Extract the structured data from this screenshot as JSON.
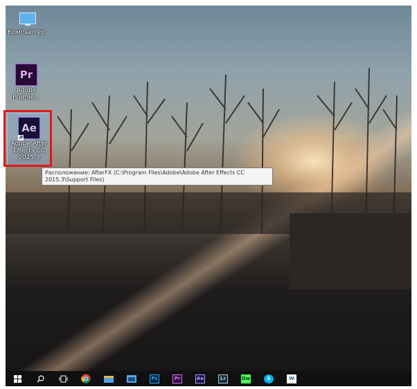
{
  "desktop": {
    "icons": [
      {
        "name": "this-pc",
        "label": "Компьютер"
      },
      {
        "name": "premiere",
        "tile": "Pr",
        "label": "Adobe Premie..."
      },
      {
        "name": "after-effects",
        "tile": "Ae",
        "label": "Adobe After Effects CC 2015.3"
      }
    ]
  },
  "tooltip": {
    "text": "Расположение: AfterFX (C:\\Program Files\\Adobe\\Adobe After Effects CC 2015.3\\Support Files)"
  },
  "taskbar": {
    "items": [
      {
        "name": "start-button",
        "icon": "windows-logo-icon"
      },
      {
        "name": "search-button",
        "icon": "search-icon"
      },
      {
        "name": "task-view-button",
        "icon": "task-view-icon"
      },
      {
        "name": "chrome-button",
        "icon": "chrome-icon"
      },
      {
        "name": "file-explorer-button",
        "icon": "folder-icon"
      },
      {
        "name": "app-button",
        "icon": "app-window-icon"
      },
      {
        "name": "photoshop-button",
        "label": "Ps",
        "color": "#31a8ff"
      },
      {
        "name": "premiere-button",
        "label": "Pr",
        "color": "#d77bff"
      },
      {
        "name": "after-effects-button",
        "label": "Ae",
        "color": "#a99cff"
      },
      {
        "name": "lightroom-button",
        "label": "Lr",
        "color": "#add5ec"
      },
      {
        "name": "dreamweaver-button",
        "label": "Dw",
        "color": "#4aff5a"
      },
      {
        "name": "skype-button",
        "label": "S",
        "color": "#00aff0"
      },
      {
        "name": "word-button",
        "label": "W",
        "color": "#2b5797"
      }
    ]
  },
  "colors": {
    "highlight": "#e01818",
    "taskbar": "#101010"
  }
}
